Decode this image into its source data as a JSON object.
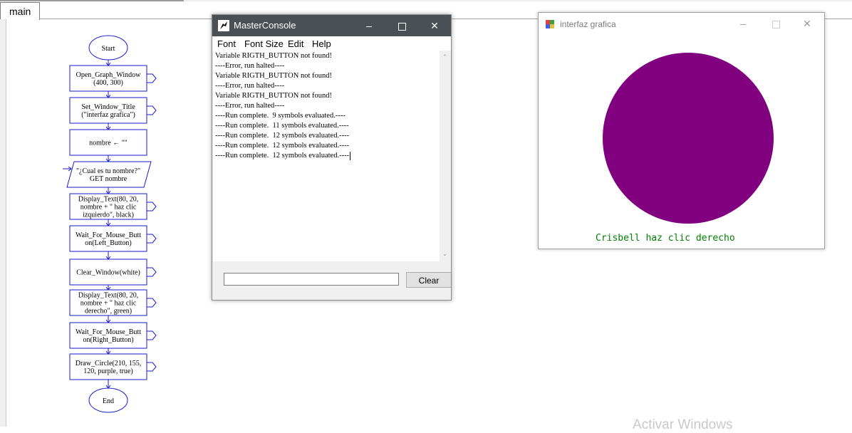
{
  "editor": {
    "tab_label": "main"
  },
  "flowchart": {
    "start": "Start",
    "end": "End",
    "steps": [
      {
        "lines": [
          "Open_Graph_Window",
          "(400,  300)"
        ]
      },
      {
        "lines": [
          "Set_Window_Title",
          "(\"interfaz grafica\")"
        ]
      },
      {
        "lines": [
          "nombre ← \"\""
        ]
      },
      {
        "lines": [
          "\"¿Cual es tu nombre?\"",
          "GET nombre"
        ]
      },
      {
        "lines": [
          "Display_Text(80, 20,",
          "nombre + \" haz clic",
          "izquierdo\", black)"
        ]
      },
      {
        "lines": [
          "Wait_For_Mouse_Butt",
          "on(Left_Button)"
        ]
      },
      {
        "lines": [
          "Clear_Window(white)"
        ]
      },
      {
        "lines": [
          "Display_Text(80, 20,",
          "nombre + \" haz clic",
          "derecho\",  green)"
        ]
      },
      {
        "lines": [
          "Wait_For_Mouse_Butt",
          "on(Right_Button)"
        ]
      },
      {
        "lines": [
          "Draw_Circle(210, 155,",
          "120, purple, true)"
        ]
      }
    ]
  },
  "console": {
    "title": "MasterConsole",
    "menu": [
      "Font",
      "Font Size",
      "Edit",
      "Help"
    ],
    "output_lines": [
      "Variable RIGTH_BUTTON not found!",
      "----Error, run halted----",
      "Variable RIGTH_BUTTON not found!",
      "----Error, run halted----",
      "Variable RIGTH_BUTTON not found!",
      "----Error, run halted----",
      "----Run complete.  9 symbols evaluated.----",
      "----Run complete.  11 symbols evaluated.----",
      "----Run complete.  12 symbols evaluated.----",
      "----Run complete.  12 symbols evaluated.----",
      "----Run complete.  12 symbols evaluated.----"
    ],
    "input_value": "",
    "clear_label": "Clear"
  },
  "graph_window": {
    "title": "interfaz grafica",
    "message": "Crisbell haz clic derecho",
    "circle_color": "#800080",
    "message_color": "#008000"
  },
  "watermark": "Activar Windows",
  "colors": {
    "flow_stroke": "#1a1acc",
    "console_titlebar": "#4b5054"
  }
}
